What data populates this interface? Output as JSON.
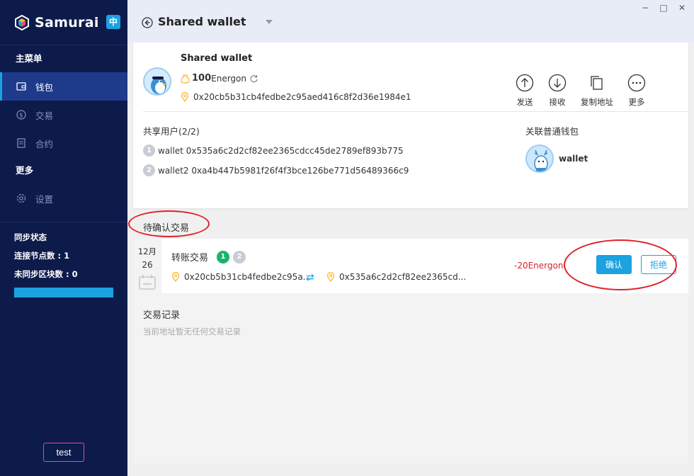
{
  "app": {
    "name": "Samurai",
    "lang_badge": "中"
  },
  "sidebar": {
    "main_menu_title": "主菜单",
    "items": [
      {
        "label": "钱包",
        "icon": "wallet-icon",
        "active": true
      },
      {
        "label": "交易",
        "icon": "dollar-icon",
        "active": false
      },
      {
        "label": "合约",
        "icon": "contract-icon",
        "active": false
      }
    ],
    "more_title": "更多",
    "settings_label": "设置",
    "sync": {
      "title": "同步状态",
      "connected_label": "连接节点数 : 1",
      "unsynced_label": "未同步区块数 : 0"
    },
    "test_button": "test"
  },
  "header": {
    "title": "Shared wallet",
    "window": {
      "minimize": "−",
      "maximize": "□",
      "close": "✕"
    }
  },
  "wallet": {
    "name": "Shared wallet",
    "balance_value": "100",
    "balance_unit": "Energon",
    "address": "0x20cb5b31cb4fedbe2c95aed416c8f2d36e1984e1",
    "actions": [
      {
        "label": "发送",
        "icon": "arrow-up-icon"
      },
      {
        "label": "接收",
        "icon": "arrow-down-icon"
      },
      {
        "label": "复制地址",
        "icon": "copy-icon"
      },
      {
        "label": "更多",
        "icon": "more-icon"
      }
    ],
    "shared_title": "共享用户(2/2)",
    "members": [
      {
        "index": "1",
        "text": "wallet 0x535a6c2d2cf82ee2365cdcc45de2789ef893b775"
      },
      {
        "index": "2",
        "text": "wallet2 0xa4b447b5981f26f4f3bce126be771d56489366c9"
      }
    ],
    "linked_title": "关联普通钱包",
    "linked_name": "wallet"
  },
  "pending": {
    "title": "待确认交易",
    "tx": {
      "month": "12月",
      "day": "26",
      "type": "转账交易",
      "sig1": "1",
      "sig2": "2",
      "from": "0x20cb5b31cb4fedbe2c95a...",
      "to": "0x535a6c2d2cf82ee2365cd...",
      "amount": "-20Energon",
      "confirm_label": "确认",
      "reject_label": "拒绝"
    }
  },
  "history": {
    "title": "交易记录",
    "empty_text": "当前地址暂无任何交易记录"
  },
  "colors": {
    "sidebar": "#0d1b4b",
    "accent": "#1ba2e0",
    "negative": "#e0202a",
    "signed": "#1bb36c"
  }
}
